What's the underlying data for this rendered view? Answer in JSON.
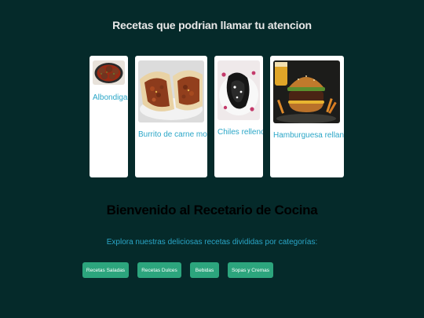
{
  "header": {
    "title": "Recetas que podrian llamar tu atencion"
  },
  "recipes": [
    {
      "name": "Albondigas",
      "image_icon": "meatballs-photo"
    },
    {
      "name": "Burrito de carne molida",
      "image_icon": "burrito-photo"
    },
    {
      "name": "Chiles rellenos",
      "image_icon": "chiles-rellenos-photo"
    },
    {
      "name": "Hamburguesa rellana de",
      "image_icon": "hamburger-photo"
    }
  ],
  "welcome": {
    "title": "Bienvenido al Recetario de Cocina",
    "subtitle": "Explora nuestras deliciosas recetas divididas por categorías:"
  },
  "categories": [
    {
      "label": "Recetas Saladas"
    },
    {
      "label": "Recetas Dulces"
    },
    {
      "label": "Bebidas"
    },
    {
      "label": "Sopas y Cremas"
    }
  ],
  "colors": {
    "background": "#052a2a",
    "link": "#2aa6c7",
    "button": "#2ca57d"
  }
}
